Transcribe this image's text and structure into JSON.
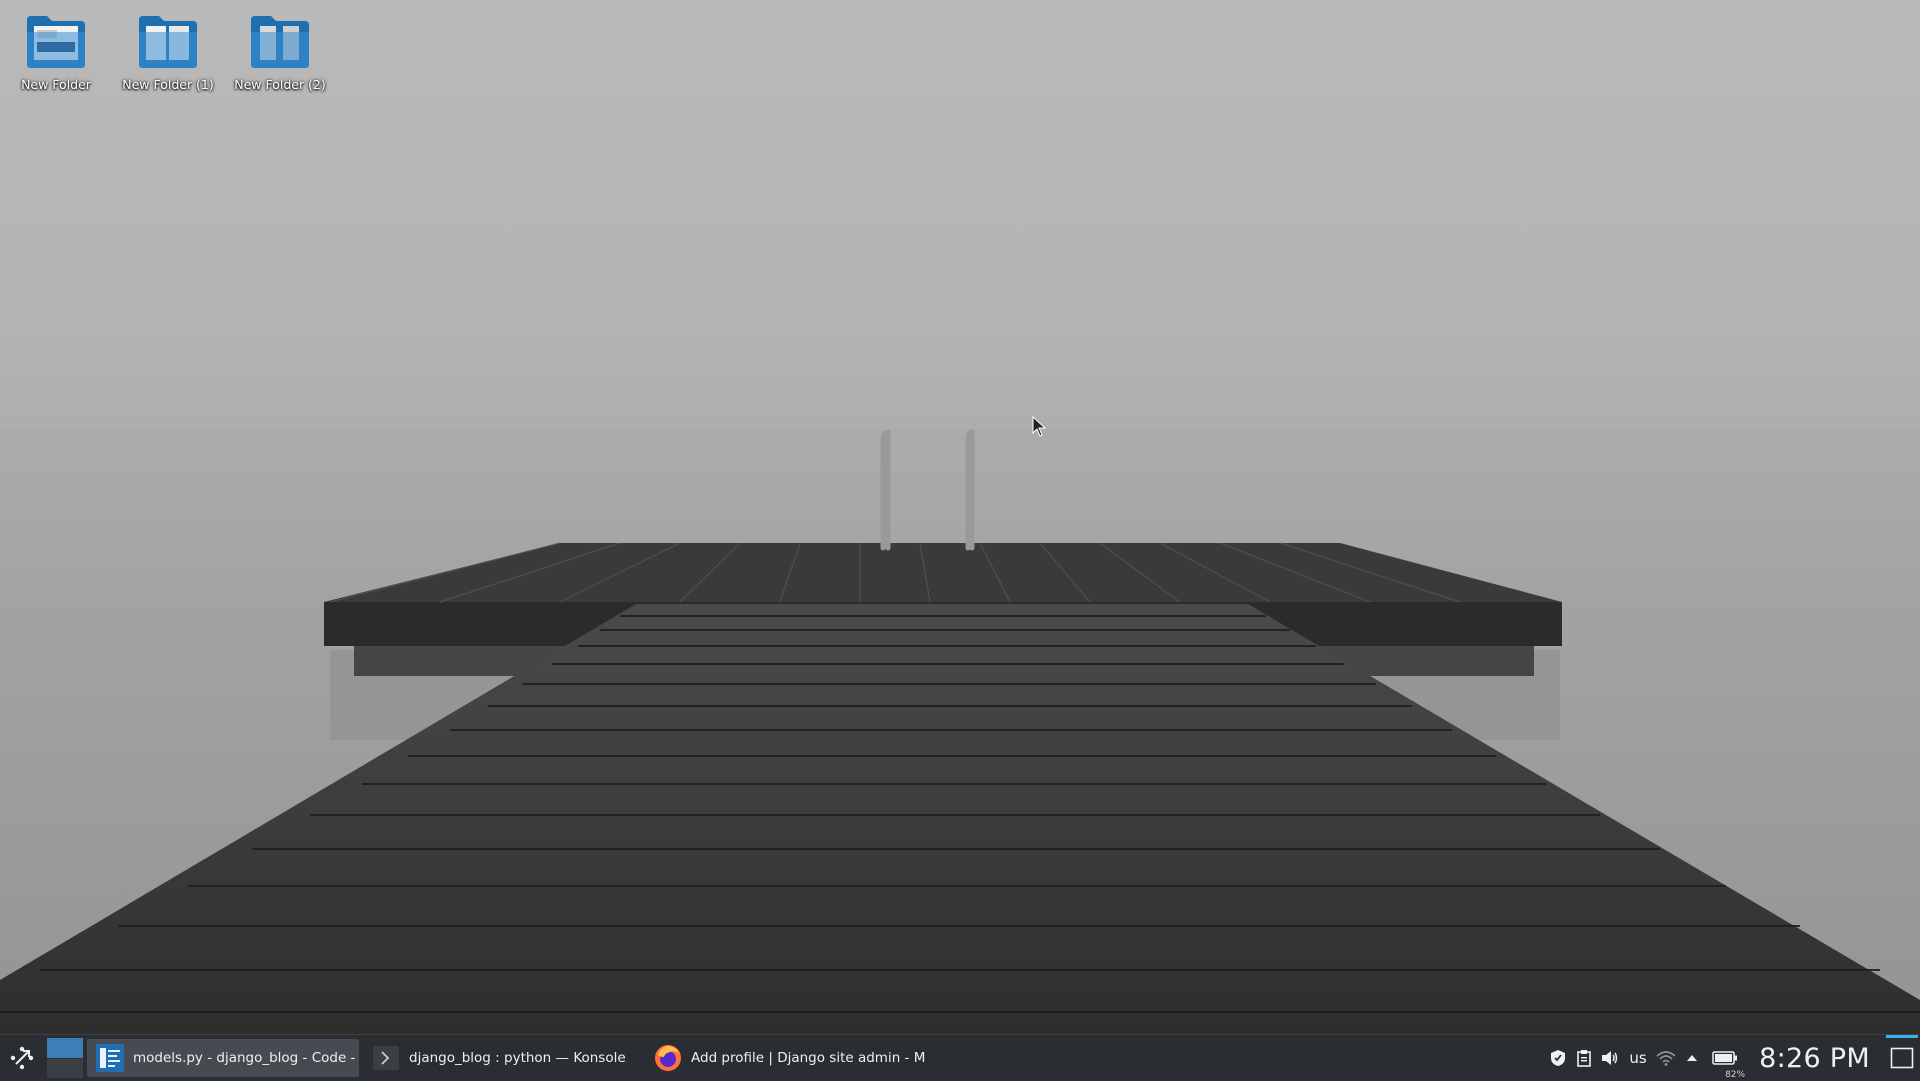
{
  "desktop": {
    "icons": [
      {
        "label": "New Folder",
        "icon": "folder-icon"
      },
      {
        "label": "New Folder (1)",
        "icon": "folder-icon"
      },
      {
        "label": "New Folder (2)",
        "icon": "folder-icon"
      }
    ]
  },
  "taskbar": {
    "tasks": [
      {
        "label": "models.py - django_blog - Code - O...",
        "icon": "vscode-icon",
        "active": true
      },
      {
        "label": "django_blog : python — Konsole",
        "icon": "konsole-icon",
        "active": false
      },
      {
        "label": "Add profile | Django site admin - M...",
        "icon": "firefox-icon",
        "active": false
      }
    ],
    "tray": {
      "keyboard_layout": "us",
      "battery_percent": "82%",
      "clock": "8:26 PM"
    }
  },
  "colors": {
    "panel_bg": "#2a2e32",
    "accent": "#3daee9",
    "folder_blue": "#3d8fd1"
  }
}
